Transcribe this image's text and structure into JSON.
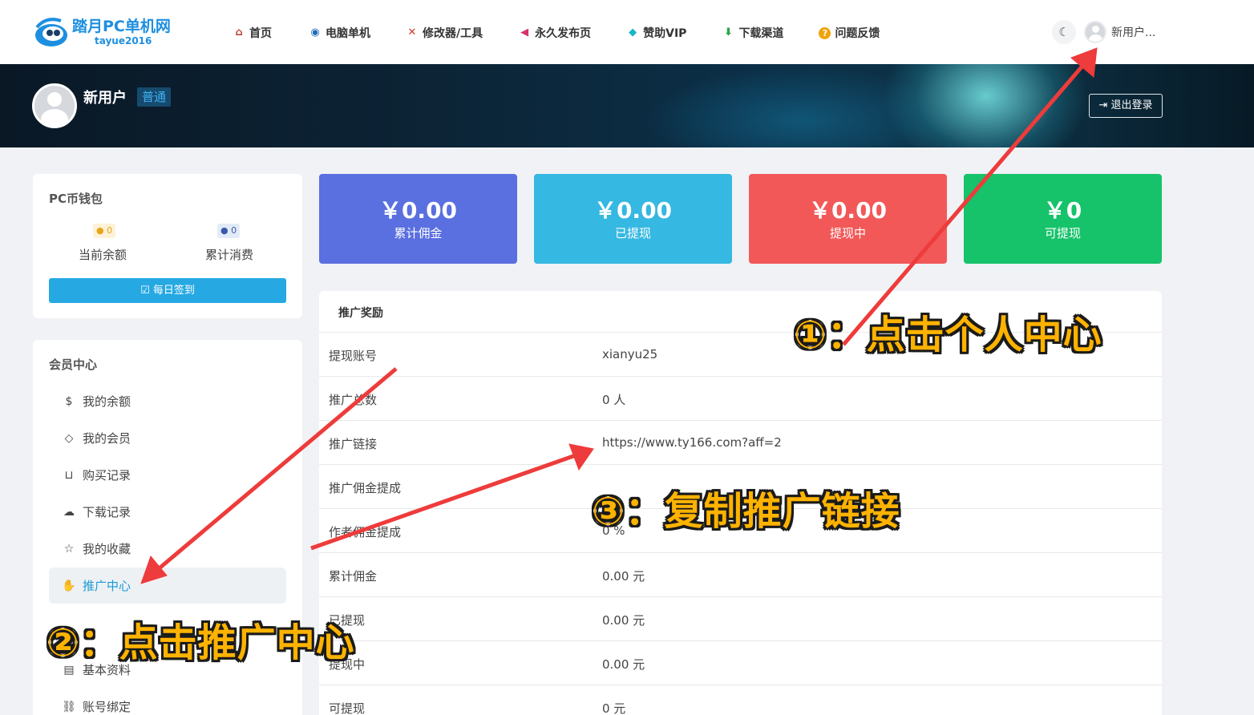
{
  "site": {
    "title": "踏月PC单机网",
    "subtitle": "tayue2016"
  },
  "nav": [
    {
      "label": "首页",
      "icon": "house-icon"
    },
    {
      "label": "电脑单机",
      "icon": "gamepad-icon"
    },
    {
      "label": "修改器/工具",
      "icon": "tools-icon"
    },
    {
      "label": "永久发布页",
      "icon": "megaphone-icon"
    },
    {
      "label": "赞助VIP",
      "icon": "diamond-icon"
    },
    {
      "label": "下载渠道",
      "icon": "download-icon"
    },
    {
      "label": "问题反馈",
      "icon": "question-icon"
    }
  ],
  "header": {
    "theme_icon": "moon-icon",
    "user_name": "新用户..."
  },
  "banner": {
    "user_name": "新用户",
    "level": "普通",
    "logout_label": "退出登录"
  },
  "wallet": {
    "title": "PC币钱包",
    "balance_value": "0",
    "balance_label": "当前余额",
    "spent_value": "0",
    "spent_label": "累计消费",
    "signin_label": "每日签到"
  },
  "member_center": {
    "title": "会员中心",
    "items": [
      {
        "label": "我的余额",
        "icon": "dollar-circle-icon"
      },
      {
        "label": "我的会员",
        "icon": "diamond-icon"
      },
      {
        "label": "购买记录",
        "icon": "basket-icon"
      },
      {
        "label": "下载记录",
        "icon": "cloud-download-icon"
      },
      {
        "label": "我的收藏",
        "icon": "star-icon"
      },
      {
        "label": "推广中心",
        "icon": "hand-coin-icon"
      },
      {
        "label": "基本资料",
        "icon": "id-card-icon"
      },
      {
        "label": "账号绑定",
        "icon": "link-icon"
      }
    ]
  },
  "stats": [
    {
      "value": "￥0.00",
      "label": "累计佣金",
      "color": "#5a6fe0"
    },
    {
      "value": "￥0.00",
      "label": "已提现",
      "color": "#35b8e2"
    },
    {
      "value": "￥0.00",
      "label": "提现中",
      "color": "#f25858"
    },
    {
      "value": "￥0",
      "label": "可提现",
      "color": "#16c26a"
    }
  ],
  "promo": {
    "title": "推广奖励",
    "rows": [
      {
        "key": "提现账号",
        "value": "xianyu25"
      },
      {
        "key": "推广总数",
        "value": "0 人"
      },
      {
        "key": "推广链接",
        "value": "https://www.ty166.com?aff=2"
      },
      {
        "key": "推广佣金提成",
        "value": ""
      },
      {
        "key": "作者佣金提成",
        "value": "0 %"
      },
      {
        "key": "累计佣金",
        "value": "0.00 元"
      },
      {
        "key": "已提现",
        "value": "0.00 元"
      },
      {
        "key": "提现中",
        "value": "0.00 元"
      },
      {
        "key": "可提现",
        "value": "0 元"
      }
    ]
  },
  "annotations": {
    "step1": "①：点击个人中心",
    "step2": "②：点击推广中心",
    "step3": "③：复制推广链接",
    "arrow_color": "#ee3b3b"
  }
}
